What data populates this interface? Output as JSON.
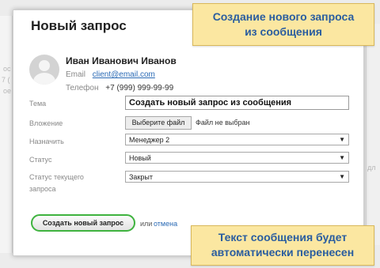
{
  "modal": {
    "title": "Новый запрос",
    "client": {
      "name": "Иван Иванович Иванов",
      "email_label": "Email",
      "email": "client@email.com",
      "phone_label": "Телефон",
      "phone": "+7 (999) 999-99-99"
    },
    "form": {
      "subject_label": "Тема",
      "subject_value": "Создать новый запрос из сообщения",
      "attachment_label": "Вложение",
      "file_button": "Выберите файл",
      "file_status": "Файл не выбран",
      "assign_label": "Назначить",
      "assign_value": "Менеджер 2",
      "status_label": "Статус",
      "status_value": "Новый",
      "current_status_label_1": "Статус текущего",
      "current_status_label_2": "запроса",
      "current_status_value": "Закрыт",
      "dropdown_arrow": "▼"
    },
    "actions": {
      "submit_label": "Создать новый запрос",
      "or_text": "или",
      "cancel_label": "отмена"
    }
  },
  "callouts": {
    "top_line1": "Создание нового запроса",
    "top_line2": "из сообщения",
    "bottom_line1": "Текст сообщения будет",
    "bottom_line2": "автоматически перенесен"
  },
  "background": {
    "frag_1": "ос",
    "frag_2": "7 (",
    "frag_3": "ое",
    "frag_4": "дл"
  },
  "colors": {
    "submit_border": "#3fb33f",
    "callout_bg": "#fbe7a1",
    "callout_text": "#2a5d9f",
    "link": "#2a6ab5"
  },
  "icons": {
    "avatar": "user-avatar-placeholder"
  }
}
